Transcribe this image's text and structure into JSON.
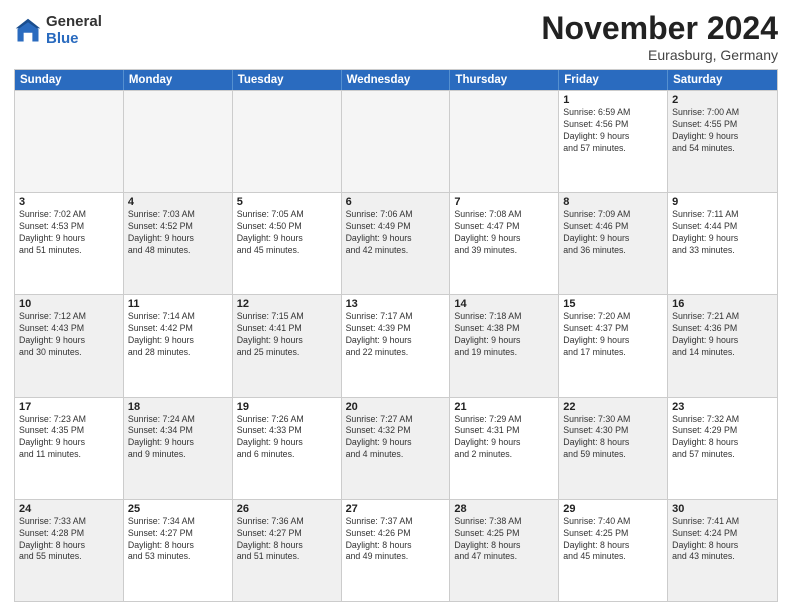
{
  "logo": {
    "general": "General",
    "blue": "Blue"
  },
  "title": {
    "month": "November 2024",
    "location": "Eurasburg, Germany"
  },
  "header_days": [
    "Sunday",
    "Monday",
    "Tuesday",
    "Wednesday",
    "Thursday",
    "Friday",
    "Saturday"
  ],
  "rows": [
    [
      {
        "day": "",
        "lines": [],
        "shade": "empty"
      },
      {
        "day": "",
        "lines": [],
        "shade": "empty"
      },
      {
        "day": "",
        "lines": [],
        "shade": "empty"
      },
      {
        "day": "",
        "lines": [],
        "shade": "empty"
      },
      {
        "day": "",
        "lines": [],
        "shade": "empty"
      },
      {
        "day": "1",
        "lines": [
          "Sunrise: 6:59 AM",
          "Sunset: 4:56 PM",
          "Daylight: 9 hours",
          "and 57 minutes."
        ],
        "shade": ""
      },
      {
        "day": "2",
        "lines": [
          "Sunrise: 7:00 AM",
          "Sunset: 4:55 PM",
          "Daylight: 9 hours",
          "and 54 minutes."
        ],
        "shade": "shaded"
      }
    ],
    [
      {
        "day": "3",
        "lines": [
          "Sunrise: 7:02 AM",
          "Sunset: 4:53 PM",
          "Daylight: 9 hours",
          "and 51 minutes."
        ],
        "shade": ""
      },
      {
        "day": "4",
        "lines": [
          "Sunrise: 7:03 AM",
          "Sunset: 4:52 PM",
          "Daylight: 9 hours",
          "and 48 minutes."
        ],
        "shade": "shaded"
      },
      {
        "day": "5",
        "lines": [
          "Sunrise: 7:05 AM",
          "Sunset: 4:50 PM",
          "Daylight: 9 hours",
          "and 45 minutes."
        ],
        "shade": ""
      },
      {
        "day": "6",
        "lines": [
          "Sunrise: 7:06 AM",
          "Sunset: 4:49 PM",
          "Daylight: 9 hours",
          "and 42 minutes."
        ],
        "shade": "shaded"
      },
      {
        "day": "7",
        "lines": [
          "Sunrise: 7:08 AM",
          "Sunset: 4:47 PM",
          "Daylight: 9 hours",
          "and 39 minutes."
        ],
        "shade": ""
      },
      {
        "day": "8",
        "lines": [
          "Sunrise: 7:09 AM",
          "Sunset: 4:46 PM",
          "Daylight: 9 hours",
          "and 36 minutes."
        ],
        "shade": "shaded"
      },
      {
        "day": "9",
        "lines": [
          "Sunrise: 7:11 AM",
          "Sunset: 4:44 PM",
          "Daylight: 9 hours",
          "and 33 minutes."
        ],
        "shade": ""
      }
    ],
    [
      {
        "day": "10",
        "lines": [
          "Sunrise: 7:12 AM",
          "Sunset: 4:43 PM",
          "Daylight: 9 hours",
          "and 30 minutes."
        ],
        "shade": "shaded"
      },
      {
        "day": "11",
        "lines": [
          "Sunrise: 7:14 AM",
          "Sunset: 4:42 PM",
          "Daylight: 9 hours",
          "and 28 minutes."
        ],
        "shade": ""
      },
      {
        "day": "12",
        "lines": [
          "Sunrise: 7:15 AM",
          "Sunset: 4:41 PM",
          "Daylight: 9 hours",
          "and 25 minutes."
        ],
        "shade": "shaded"
      },
      {
        "day": "13",
        "lines": [
          "Sunrise: 7:17 AM",
          "Sunset: 4:39 PM",
          "Daylight: 9 hours",
          "and 22 minutes."
        ],
        "shade": ""
      },
      {
        "day": "14",
        "lines": [
          "Sunrise: 7:18 AM",
          "Sunset: 4:38 PM",
          "Daylight: 9 hours",
          "and 19 minutes."
        ],
        "shade": "shaded"
      },
      {
        "day": "15",
        "lines": [
          "Sunrise: 7:20 AM",
          "Sunset: 4:37 PM",
          "Daylight: 9 hours",
          "and 17 minutes."
        ],
        "shade": ""
      },
      {
        "day": "16",
        "lines": [
          "Sunrise: 7:21 AM",
          "Sunset: 4:36 PM",
          "Daylight: 9 hours",
          "and 14 minutes."
        ],
        "shade": "shaded"
      }
    ],
    [
      {
        "day": "17",
        "lines": [
          "Sunrise: 7:23 AM",
          "Sunset: 4:35 PM",
          "Daylight: 9 hours",
          "and 11 minutes."
        ],
        "shade": ""
      },
      {
        "day": "18",
        "lines": [
          "Sunrise: 7:24 AM",
          "Sunset: 4:34 PM",
          "Daylight: 9 hours",
          "and 9 minutes."
        ],
        "shade": "shaded"
      },
      {
        "day": "19",
        "lines": [
          "Sunrise: 7:26 AM",
          "Sunset: 4:33 PM",
          "Daylight: 9 hours",
          "and 6 minutes."
        ],
        "shade": ""
      },
      {
        "day": "20",
        "lines": [
          "Sunrise: 7:27 AM",
          "Sunset: 4:32 PM",
          "Daylight: 9 hours",
          "and 4 minutes."
        ],
        "shade": "shaded"
      },
      {
        "day": "21",
        "lines": [
          "Sunrise: 7:29 AM",
          "Sunset: 4:31 PM",
          "Daylight: 9 hours",
          "and 2 minutes."
        ],
        "shade": ""
      },
      {
        "day": "22",
        "lines": [
          "Sunrise: 7:30 AM",
          "Sunset: 4:30 PM",
          "Daylight: 8 hours",
          "and 59 minutes."
        ],
        "shade": "shaded"
      },
      {
        "day": "23",
        "lines": [
          "Sunrise: 7:32 AM",
          "Sunset: 4:29 PM",
          "Daylight: 8 hours",
          "and 57 minutes."
        ],
        "shade": ""
      }
    ],
    [
      {
        "day": "24",
        "lines": [
          "Sunrise: 7:33 AM",
          "Sunset: 4:28 PM",
          "Daylight: 8 hours",
          "and 55 minutes."
        ],
        "shade": "shaded"
      },
      {
        "day": "25",
        "lines": [
          "Sunrise: 7:34 AM",
          "Sunset: 4:27 PM",
          "Daylight: 8 hours",
          "and 53 minutes."
        ],
        "shade": ""
      },
      {
        "day": "26",
        "lines": [
          "Sunrise: 7:36 AM",
          "Sunset: 4:27 PM",
          "Daylight: 8 hours",
          "and 51 minutes."
        ],
        "shade": "shaded"
      },
      {
        "day": "27",
        "lines": [
          "Sunrise: 7:37 AM",
          "Sunset: 4:26 PM",
          "Daylight: 8 hours",
          "and 49 minutes."
        ],
        "shade": ""
      },
      {
        "day": "28",
        "lines": [
          "Sunrise: 7:38 AM",
          "Sunset: 4:25 PM",
          "Daylight: 8 hours",
          "and 47 minutes."
        ],
        "shade": "shaded"
      },
      {
        "day": "29",
        "lines": [
          "Sunrise: 7:40 AM",
          "Sunset: 4:25 PM",
          "Daylight: 8 hours",
          "and 45 minutes."
        ],
        "shade": ""
      },
      {
        "day": "30",
        "lines": [
          "Sunrise: 7:41 AM",
          "Sunset: 4:24 PM",
          "Daylight: 8 hours",
          "and 43 minutes."
        ],
        "shade": "shaded"
      }
    ]
  ]
}
